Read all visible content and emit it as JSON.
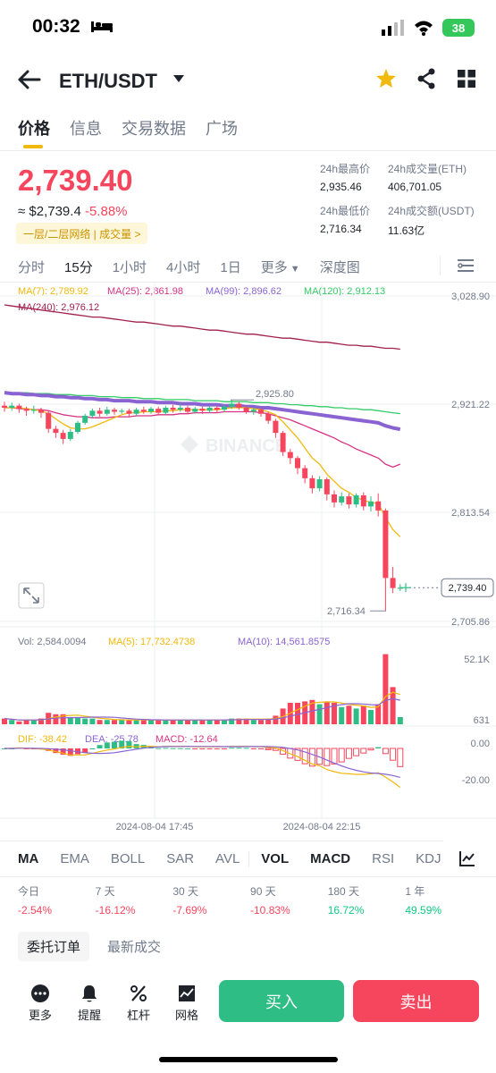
{
  "status": {
    "time": "00:32",
    "battery": "38"
  },
  "header": {
    "pair": "ETH/USDT"
  },
  "tabs": [
    "价格",
    "信息",
    "交易数据",
    "广场"
  ],
  "price": {
    "last": "2,739.40",
    "approx": "≈ $2,739.4",
    "change": "-5.88%",
    "tag": "一层/二层网络 | 成交量 >"
  },
  "stats": {
    "high_label": "24h最高价",
    "high": "2,935.46",
    "volume_label": "24h成交量(ETH)",
    "volume": "406,701.05",
    "low_label": "24h最低价",
    "low": "2,716.34",
    "turnover_label": "24h成交额(USDT)",
    "turnover": "11.63亿"
  },
  "intervals": [
    "分时",
    "15分",
    "1小时",
    "4小时",
    "1日",
    "更多",
    "深度图"
  ],
  "ma_legend": {
    "ma7": "MA(7): 2,789.92",
    "ma25": "MA(25): 2,861.98",
    "ma99": "MA(99): 2,896.62",
    "ma120": "MA(120): 2,912.13",
    "ma240": "MA(240): 2,976.12"
  },
  "colors": {
    "up": "#2ebd85",
    "down": "#f6465d",
    "accent": "#f0b90b",
    "ma7": "#f0b90b",
    "ma25": "#d63384",
    "ma99": "#8a63d2",
    "ma120": "#33cc66",
    "ma240": "#a0204a"
  },
  "chart_data": {
    "type": "candlestick",
    "price_axis": [
      "3,028.90",
      "2,921.22",
      "2,813.54",
      "2,705.86"
    ],
    "current_price": "2,739.40",
    "high_marker": "2,925.80",
    "low_marker": "2,716.34",
    "time_labels": [
      "2024-08-04 17:45",
      "2024-08-04 22:15"
    ],
    "ylim": [
      2705.86,
      3028.9
    ],
    "volume": {
      "label": "Vol: 2,584.0094",
      "ma5": "MA(5): 17,732.4738",
      "ma10": "MA(10): 14,561.8575",
      "axis": [
        "52.1K",
        "631"
      ]
    },
    "macd": {
      "dif": "DIF: -38.42",
      "dea": "DEA: -25.78",
      "macd": "MACD: -12.64",
      "axis": [
        "0.00",
        "-20.00"
      ]
    },
    "candles": [
      {
        "o": 2920,
        "c": 2918,
        "h": 2924,
        "l": 2914
      },
      {
        "o": 2918,
        "c": 2920,
        "h": 2923,
        "l": 2915
      },
      {
        "o": 2920,
        "c": 2917,
        "h": 2922,
        "l": 2913
      },
      {
        "o": 2917,
        "c": 2915,
        "h": 2919,
        "l": 2910
      },
      {
        "o": 2915,
        "c": 2916,
        "h": 2920,
        "l": 2912
      },
      {
        "o": 2916,
        "c": 2913,
        "h": 2918,
        "l": 2908
      },
      {
        "o": 2913,
        "c": 2897,
        "h": 2915,
        "l": 2893
      },
      {
        "o": 2897,
        "c": 2893,
        "h": 2900,
        "l": 2888
      },
      {
        "o": 2893,
        "c": 2887,
        "h": 2896,
        "l": 2882
      },
      {
        "o": 2887,
        "c": 2894,
        "h": 2897,
        "l": 2885
      },
      {
        "o": 2894,
        "c": 2903,
        "h": 2905,
        "l": 2892
      },
      {
        "o": 2903,
        "c": 2910,
        "h": 2912,
        "l": 2901
      },
      {
        "o": 2910,
        "c": 2915,
        "h": 2917,
        "l": 2908
      },
      {
        "o": 2915,
        "c": 2912,
        "h": 2918,
        "l": 2909
      },
      {
        "o": 2912,
        "c": 2916,
        "h": 2919,
        "l": 2910
      },
      {
        "o": 2916,
        "c": 2914,
        "h": 2918,
        "l": 2911
      },
      {
        "o": 2914,
        "c": 2915,
        "h": 2917,
        "l": 2912
      },
      {
        "o": 2915,
        "c": 2912,
        "h": 2917,
        "l": 2909
      },
      {
        "o": 2912,
        "c": 2916,
        "h": 2918,
        "l": 2910
      },
      {
        "o": 2916,
        "c": 2914,
        "h": 2919,
        "l": 2912
      },
      {
        "o": 2914,
        "c": 2917,
        "h": 2919,
        "l": 2912
      },
      {
        "o": 2917,
        "c": 2913,
        "h": 2919,
        "l": 2911
      },
      {
        "o": 2913,
        "c": 2918,
        "h": 2920,
        "l": 2911
      },
      {
        "o": 2918,
        "c": 2916,
        "h": 2921,
        "l": 2913
      },
      {
        "o": 2916,
        "c": 2918,
        "h": 2922,
        "l": 2914
      },
      {
        "o": 2918,
        "c": 2914,
        "h": 2920,
        "l": 2912
      },
      {
        "o": 2914,
        "c": 2917,
        "h": 2919,
        "l": 2912
      },
      {
        "o": 2917,
        "c": 2915,
        "h": 2919,
        "l": 2912
      },
      {
        "o": 2915,
        "c": 2918,
        "h": 2920,
        "l": 2913
      },
      {
        "o": 2918,
        "c": 2916,
        "h": 2920,
        "l": 2913
      },
      {
        "o": 2916,
        "c": 2919,
        "h": 2921,
        "l": 2914
      },
      {
        "o": 2919,
        "c": 2922,
        "h": 2925.8,
        "l": 2917
      },
      {
        "o": 2922,
        "c": 2918,
        "h": 2924,
        "l": 2916
      },
      {
        "o": 2918,
        "c": 2914,
        "h": 2920,
        "l": 2912
      },
      {
        "o": 2914,
        "c": 2916,
        "h": 2918,
        "l": 2911
      },
      {
        "o": 2916,
        "c": 2912,
        "h": 2918,
        "l": 2909
      },
      {
        "o": 2912,
        "c": 2905,
        "h": 2914,
        "l": 2902
      },
      {
        "o": 2905,
        "c": 2893,
        "h": 2907,
        "l": 2888
      },
      {
        "o": 2893,
        "c": 2874,
        "h": 2895,
        "l": 2870
      },
      {
        "o": 2874,
        "c": 2868,
        "h": 2877,
        "l": 2862
      },
      {
        "o": 2868,
        "c": 2858,
        "h": 2870,
        "l": 2852
      },
      {
        "o": 2858,
        "c": 2848,
        "h": 2861,
        "l": 2843
      },
      {
        "o": 2848,
        "c": 2838,
        "h": 2851,
        "l": 2833
      },
      {
        "o": 2838,
        "c": 2847,
        "h": 2850,
        "l": 2835
      },
      {
        "o": 2847,
        "c": 2832,
        "h": 2849,
        "l": 2826
      },
      {
        "o": 2832,
        "c": 2824,
        "h": 2836,
        "l": 2819
      },
      {
        "o": 2824,
        "c": 2830,
        "h": 2834,
        "l": 2821
      },
      {
        "o": 2830,
        "c": 2822,
        "h": 2833,
        "l": 2818
      },
      {
        "o": 2822,
        "c": 2831,
        "h": 2833,
        "l": 2819
      },
      {
        "o": 2831,
        "c": 2820,
        "h": 2834,
        "l": 2816
      },
      {
        "o": 2820,
        "c": 2825,
        "h": 2830,
        "l": 2815
      },
      {
        "o": 2825,
        "c": 2816,
        "h": 2833,
        "l": 2810
      },
      {
        "o": 2816,
        "c": 2749,
        "h": 2818,
        "l": 2716.34
      },
      {
        "o": 2749,
        "c": 2739,
        "h": 2760,
        "l": 2734
      },
      {
        "o": 2739,
        "c": 2739.4,
        "h": 2743,
        "l": 2736
      }
    ],
    "volumes": [
      0.4,
      0.3,
      0.2,
      0.3,
      0.3,
      0.4,
      0.8,
      0.7,
      0.7,
      0.5,
      0.5,
      0.4,
      0.4,
      0.3,
      0.3,
      0.3,
      0.3,
      0.3,
      0.3,
      0.3,
      0.3,
      0.3,
      0.3,
      0.3,
      0.3,
      0.3,
      0.3,
      0.3,
      0.3,
      0.3,
      0.3,
      0.4,
      0.4,
      0.4,
      0.3,
      0.3,
      0.4,
      0.6,
      1.1,
      1.5,
      1.5,
      1.6,
      1.7,
      1.4,
      1.6,
      1.5,
      1.2,
      1.3,
      1.1,
      1.3,
      1.0,
      1.4,
      4.9,
      2.6,
      0.5
    ],
    "ma_lines": {
      "ma7": [
        2918,
        2918,
        2918,
        2917,
        2916,
        2915,
        2912,
        2907,
        2902,
        2898,
        2897,
        2897,
        2899,
        2902,
        2905,
        2908,
        2911,
        2913,
        2913,
        2914,
        2914,
        2914,
        2915,
        2915,
        2916,
        2916,
        2916,
        2916,
        2916,
        2916,
        2917,
        2918,
        2918,
        2918,
        2917,
        2916,
        2914,
        2911,
        2904,
        2896,
        2888,
        2878,
        2868,
        2862,
        2852,
        2845,
        2838,
        2834,
        2829,
        2826,
        2824,
        2823,
        2809,
        2797,
        2789.92
      ],
      "ma25": [
        2918,
        2918,
        2917,
        2917,
        2916,
        2916,
        2915,
        2913,
        2911,
        2910,
        2909,
        2909,
        2908,
        2908,
        2908,
        2909,
        2909,
        2909,
        2910,
        2910,
        2910,
        2911,
        2911,
        2911,
        2912,
        2912,
        2913,
        2913,
        2913,
        2913,
        2914,
        2914,
        2914,
        2914,
        2914,
        2913,
        2912,
        2910,
        2908,
        2906,
        2903,
        2900,
        2897,
        2894,
        2891,
        2888,
        2884,
        2881,
        2877,
        2874,
        2871,
        2868,
        2862,
        2859,
        2861.98
      ],
      "ma99": [
        2933,
        2932,
        2932,
        2931,
        2931,
        2930,
        2930,
        2929,
        2929,
        2928,
        2928,
        2927,
        2927,
        2926,
        2926,
        2925,
        2925,
        2925,
        2924,
        2924,
        2924,
        2923,
        2923,
        2923,
        2922,
        2922,
        2922,
        2921,
        2921,
        2921,
        2920,
        2920,
        2920,
        2919,
        2919,
        2918,
        2918,
        2917,
        2916,
        2915,
        2914,
        2913,
        2912,
        2911,
        2910,
        2909,
        2908,
        2907,
        2906,
        2905,
        2904,
        2903,
        2900,
        2898,
        2896.62
      ],
      "ma120": [
        2934,
        2933,
        2933,
        2933,
        2932,
        2932,
        2932,
        2931,
        2931,
        2931,
        2930,
        2930,
        2930,
        2929,
        2929,
        2929,
        2928,
        2928,
        2928,
        2927,
        2927,
        2927,
        2926,
        2926,
        2926,
        2926,
        2925,
        2925,
        2925,
        2925,
        2924,
        2924,
        2924,
        2924,
        2923,
        2923,
        2923,
        2922,
        2922,
        2921,
        2921,
        2920,
        2920,
        2919,
        2919,
        2918,
        2918,
        2917,
        2917,
        2916,
        2916,
        2915,
        2914,
        2913,
        2912.13
      ],
      "ma240": [
        3020,
        3019,
        3018,
        3017,
        3016,
        3015,
        3014,
        3013,
        3012,
        3011,
        3010,
        3009,
        3008,
        3008,
        3007,
        3006,
        3005,
        3004,
        3003,
        3003,
        3002,
        3001,
        3000,
        2999,
        2999,
        2998,
        2997,
        2996,
        2995,
        2995,
        2994,
        2993,
        2992,
        2991,
        2991,
        2990,
        2989,
        2988,
        2987,
        2987,
        2986,
        2985,
        2984,
        2983,
        2983,
        2982,
        2981,
        2980,
        2980,
        2979,
        2979,
        2978,
        2977,
        2977,
        2976.12
      ]
    }
  },
  "indicators": [
    "MA",
    "EMA",
    "BOLL",
    "SAR",
    "AVL",
    "VOL",
    "MACD",
    "RSI",
    "KDJ"
  ],
  "performance": [
    {
      "label": "今日",
      "value": "-2.54%",
      "pos": false
    },
    {
      "label": "7 天",
      "value": "-16.12%",
      "pos": false
    },
    {
      "label": "30 天",
      "value": "-7.69%",
      "pos": false
    },
    {
      "label": "90 天",
      "value": "-10.83%",
      "pos": false
    },
    {
      "label": "180 天",
      "value": "16.72%",
      "pos": true
    },
    {
      "label": "1 年",
      "value": "49.59%",
      "pos": true
    }
  ],
  "orders": {
    "active": "委托订单",
    "other": "最新成交"
  },
  "bottom": {
    "more": "更多",
    "alert": "提醒",
    "leverage": "杠杆",
    "grid": "网格",
    "buy": "买入",
    "sell": "卖出"
  },
  "watermark": "BINANCE"
}
